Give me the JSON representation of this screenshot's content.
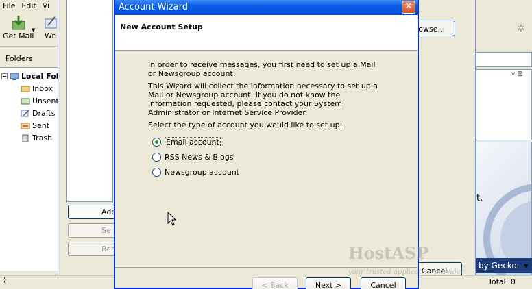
{
  "main_window": {
    "menu": [
      "File",
      "Edit",
      "Vi"
    ],
    "toolbar": {
      "get_mail": "Get Mail",
      "write": "Wri"
    },
    "folders_header": "Folders",
    "folders": {
      "root": "Local Fol",
      "items": [
        "Inbox",
        "Unsent",
        "Drafts",
        "Sent",
        "Trash"
      ]
    },
    "status_total": "Total: 0"
  },
  "account_settings": {
    "browse_label": "rowse...",
    "add_label": "Add",
    "set_label": "Se",
    "remove_label": "Rem",
    "cancel_label": "Cancel",
    "message_fragment": "t.",
    "gecko_text": "by Gecko."
  },
  "wizard": {
    "title": "Account Wizard",
    "close_symbol": "✕",
    "header": "New Account Setup",
    "para1": "In order to receive messages, you first need to set up a Mail or Newsgroup account.",
    "para2": "This Wizard will collect the information necessary to set up a Mail or Newsgroup account. If you do not know the information requested, please contact your System Administrator or Internet Service Provider.",
    "para3": "Select the type of account you would like to set up:",
    "options": [
      {
        "label": "Email account",
        "selected": true
      },
      {
        "label": "RSS News & Blogs",
        "selected": false
      },
      {
        "label": "Newsgroup account",
        "selected": false
      }
    ],
    "back_label": "< Back",
    "next_label": "Next >",
    "cancel_label": "Cancel"
  },
  "watermark": {
    "brand": "HostASP",
    "tagline": "your trusted application provider"
  },
  "colors": {
    "title_bar": "#0a5de6",
    "radio_checked": "#21a121",
    "gecko_bar": "#1c3d7a"
  }
}
